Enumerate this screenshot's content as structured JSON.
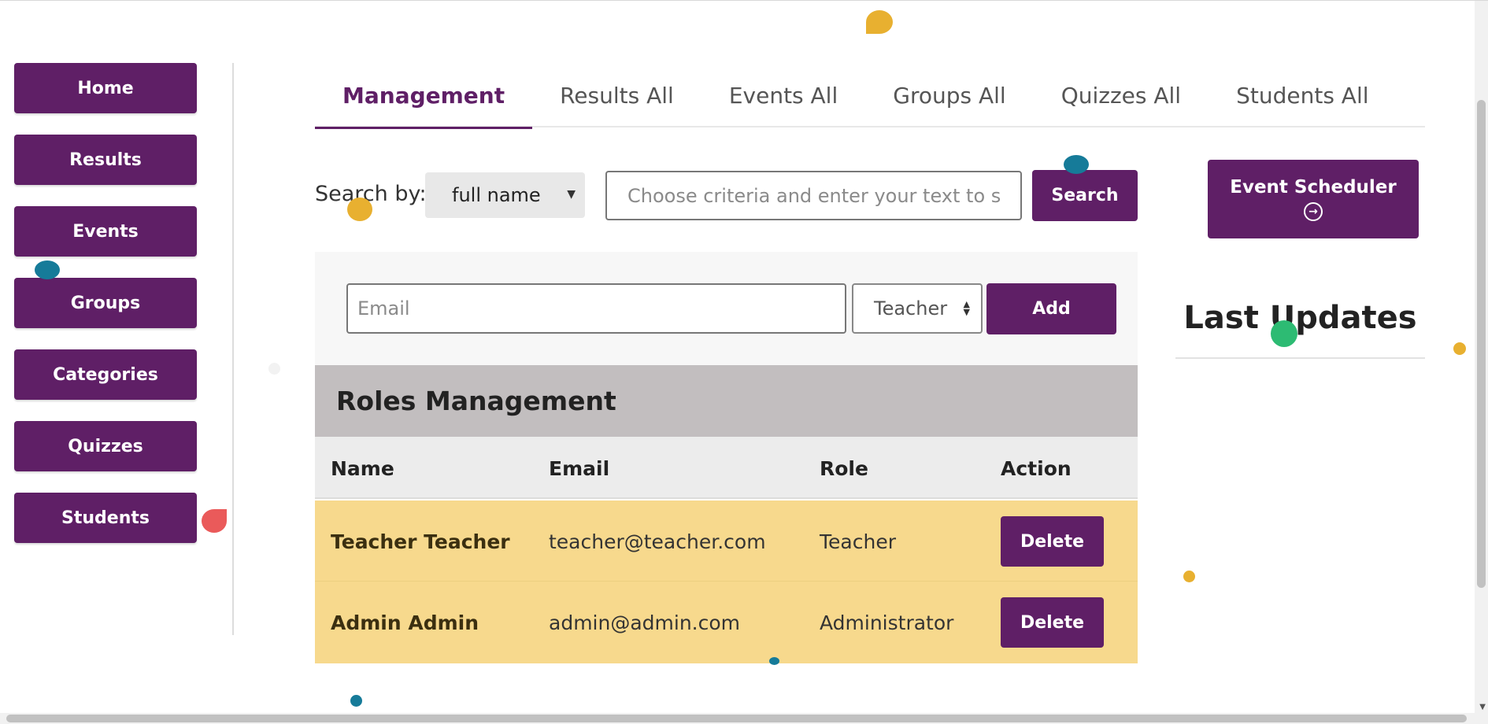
{
  "sidebar": {
    "items": [
      {
        "label": "Home"
      },
      {
        "label": "Results"
      },
      {
        "label": "Events"
      },
      {
        "label": "Groups"
      },
      {
        "label": "Categories"
      },
      {
        "label": "Quizzes"
      },
      {
        "label": "Students"
      }
    ]
  },
  "tabs": [
    {
      "label": "Management",
      "active": true
    },
    {
      "label": "Results All"
    },
    {
      "label": "Events All"
    },
    {
      "label": "Groups All"
    },
    {
      "label": "Quizzes All"
    },
    {
      "label": "Students All"
    }
  ],
  "search": {
    "label": "Search by:",
    "criteria_selected": "full name",
    "placeholder": "Choose criteria and enter your text to searc",
    "button": "Search"
  },
  "add_user": {
    "email_placeholder": "Email",
    "role_selected": "Teacher",
    "button": "Add"
  },
  "roles": {
    "title": "Roles Management",
    "columns": [
      "Name",
      "Email",
      "Role",
      "Action"
    ],
    "rows": [
      {
        "name": "Teacher Teacher",
        "email": "teacher@teacher.com",
        "role": "Teacher",
        "action": "Delete"
      },
      {
        "name": "Admin Admin",
        "email": "admin@admin.com",
        "role": "Administrator",
        "action": "Delete"
      }
    ]
  },
  "right_panel": {
    "scheduler_button": "Event Scheduler",
    "last_updates_title": "Last Updates"
  },
  "colors": {
    "brand_purple": "#5f1f66",
    "row_highlight": "#f7d98d",
    "section_header": "#c2bebf"
  }
}
